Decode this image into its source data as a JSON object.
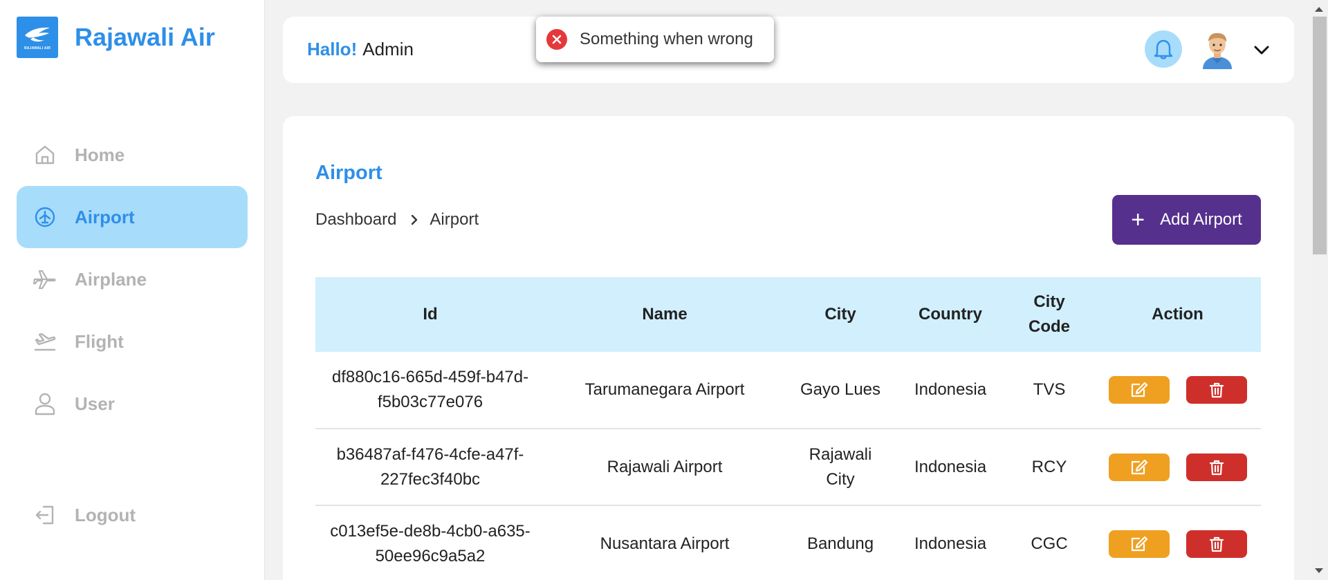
{
  "brand": {
    "name": "Rajawali Air",
    "logo_text": "RAJAWALI AIR"
  },
  "sidebar": {
    "items": [
      {
        "label": "Home",
        "icon": "home-icon",
        "active": false
      },
      {
        "label": "Airport",
        "icon": "airport-icon",
        "active": true
      },
      {
        "label": "Airplane",
        "icon": "airplane-icon",
        "active": false
      },
      {
        "label": "Flight",
        "icon": "flight-takeoff-icon",
        "active": false
      },
      {
        "label": "User",
        "icon": "user-icon",
        "active": false
      }
    ],
    "logout_label": "Logout"
  },
  "header": {
    "greeting": "Hallo!",
    "user_name": "Admin"
  },
  "toast": {
    "message": "Something when wrong",
    "type": "error"
  },
  "page": {
    "title": "Airport",
    "breadcrumb": [
      "Dashboard",
      "Airport"
    ],
    "add_button_label": "Add Airport"
  },
  "table": {
    "columns": [
      "Id",
      "Name",
      "City",
      "Country",
      "City Code",
      "Action"
    ],
    "rows": [
      {
        "id": "df880c16-665d-459f-b47d-f5b03c77e076",
        "name": "Tarumanegara Airport",
        "city": "Gayo Lues",
        "country": "Indonesia",
        "city_code": "TVS"
      },
      {
        "id": "b36487af-f476-4cfe-a47f-227fec3f40bc",
        "name": "Rajawali Airport",
        "city": "Rajawali City",
        "country": "Indonesia",
        "city_code": "RCY"
      },
      {
        "id": "c013ef5e-de8b-4cb0-a635-50ee96c9a5a2",
        "name": "Nusantara Airport",
        "city": "Bandung",
        "country": "Indonesia",
        "city_code": "CGC"
      }
    ]
  },
  "colors": {
    "accent": "#2e8fe8",
    "active_nav_bg": "#a8dcfb",
    "primary_button": "#55308c",
    "edit_button": "#efa021",
    "delete_button": "#cf2f2a",
    "table_header_bg": "#d1effd",
    "error": "#e5383b"
  }
}
